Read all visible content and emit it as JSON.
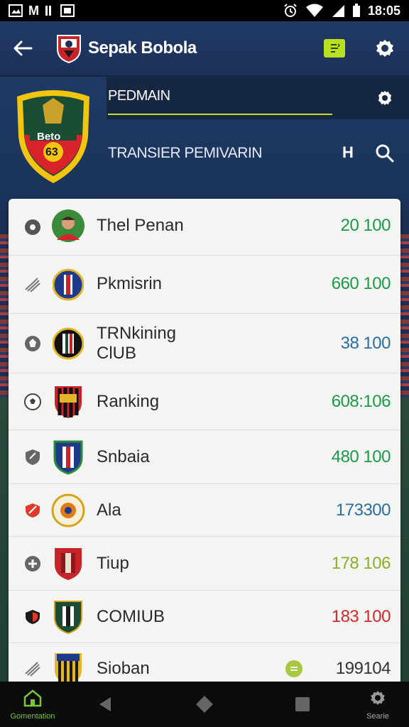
{
  "status_bar": {
    "left_label": "M",
    "time": "18:05"
  },
  "app_bar": {
    "title": "Sepak Bobola",
    "badge_icon": "sort-icon",
    "settings_icon": "gear-icon"
  },
  "hero": {
    "crest_text": "Beto",
    "crest_number": "63",
    "search_value": "PEDMAIN",
    "transfer_label": "TRANSIER PEMIVARIN",
    "h_button": "H"
  },
  "list": [
    {
      "name": "Thel Penan",
      "value": "20 100",
      "value_color": "#1a9a4a"
    },
    {
      "name": "Pkmisrin",
      "value": "660 100",
      "value_color": "#1a9a4a"
    },
    {
      "name": "TRNkining\nClUB",
      "value": "38 100",
      "value_color": "#2a6fa0"
    },
    {
      "name": "Ranking",
      "value": "608:106",
      "value_color": "#1a9a4a"
    },
    {
      "name": "Snbaia",
      "value": "480 100",
      "value_color": "#1a9a4a"
    },
    {
      "name": "Ala",
      "value": "173300",
      "value_color": "#2a6fa0"
    },
    {
      "name": "Tiup",
      "value": "178 106",
      "value_color": "#8ab02a"
    },
    {
      "name": "COMIUB",
      "value": "183 100",
      "value_color": "#d02a2a"
    },
    {
      "name": "Sioban",
      "value": "199104",
      "value_color": "#333333"
    }
  ],
  "bottom_nav": {
    "home_label": "Gomentation",
    "settings_label": "Searie"
  },
  "colors": {
    "brand_dark": "#1b2f52",
    "accent_lime": "#b9e021"
  }
}
